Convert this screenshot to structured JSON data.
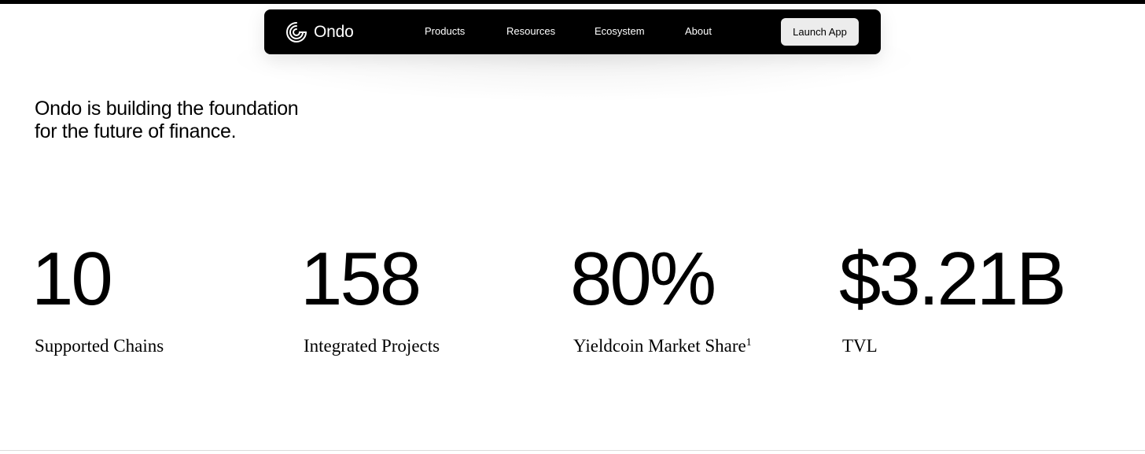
{
  "nav": {
    "logo_text": "Ondo",
    "logo_icon": "ondo-logo-icon",
    "links": [
      "Products",
      "Resources",
      "Ecosystem",
      "About"
    ],
    "launch_label": "Launch App"
  },
  "hero": {
    "headline_line1": "Ondo is building the foundation",
    "headline_line2": "for the future of finance."
  },
  "stats": [
    {
      "value": "10",
      "label": "Supported Chains",
      "footnote": ""
    },
    {
      "value": "158",
      "label": "Integrated Projects",
      "footnote": ""
    },
    {
      "value": "80%",
      "label": "Yieldcoin Market Share",
      "footnote": "1"
    },
    {
      "value": "$3.21B",
      "label": "TVL",
      "footnote": ""
    }
  ],
  "colors": {
    "nav_background": "#000000",
    "launch_button_background": "#ececec",
    "page_background": "#ffffff"
  }
}
